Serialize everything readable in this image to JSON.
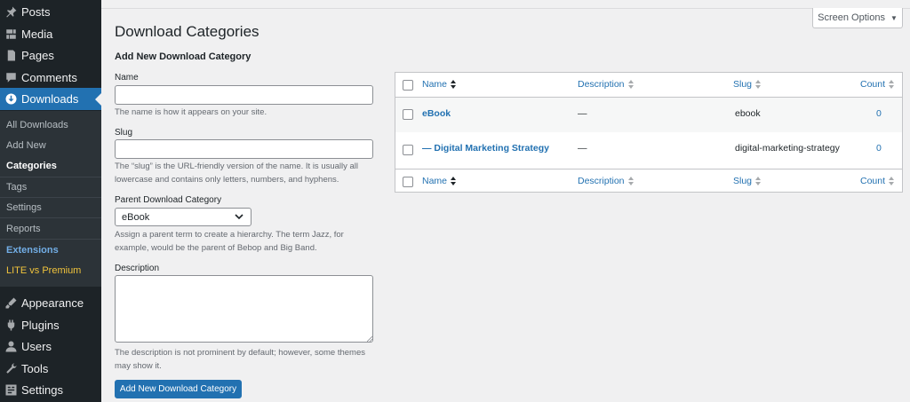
{
  "sidebar": {
    "items": [
      {
        "label": "Posts",
        "icon": "pin-icon"
      },
      {
        "label": "Media",
        "icon": "media-icon"
      },
      {
        "label": "Pages",
        "icon": "pages-icon"
      },
      {
        "label": "Comments",
        "icon": "comments-icon"
      },
      {
        "label": "Downloads",
        "icon": "download-icon"
      },
      {
        "label": "Appearance",
        "icon": "brush-icon"
      },
      {
        "label": "Plugins",
        "icon": "plugin-icon"
      },
      {
        "label": "Users",
        "icon": "users-icon"
      },
      {
        "label": "Tools",
        "icon": "wrench-icon"
      },
      {
        "label": "Settings",
        "icon": "settings-icon"
      }
    ],
    "submenu": [
      "All Downloads",
      "Add New",
      "Categories",
      "Tags",
      "Settings",
      "Reports",
      "Extensions",
      "LITE vs Premium"
    ]
  },
  "screen_options": "Screen Options",
  "page_title": "Download Categories",
  "form": {
    "title": "Add New Download Category",
    "name_label": "Name",
    "name_value": "",
    "name_help": "The name is how it appears on your site.",
    "slug_label": "Slug",
    "slug_value": "",
    "slug_help": "The “slug” is the URL-friendly version of the name. It is usually all lowercase and contains only letters, numbers, and hyphens.",
    "parent_label": "Parent Download Category",
    "parent_value": "eBook",
    "parent_help": "Assign a parent term to create a hierarchy. The term Jazz, for example, would be the parent of Bebop and Big Band.",
    "description_label": "Description",
    "description_help": "The description is not prominent by default; however, some themes may show it.",
    "submit_label": "Add New Download Category"
  },
  "table": {
    "columns": {
      "name": "Name",
      "description": "Description",
      "slug": "Slug",
      "count": "Count"
    },
    "rows": [
      {
        "name": "eBook",
        "description": "—",
        "slug": "ebook",
        "count": "0"
      },
      {
        "name": "— Digital Marketing Strategy",
        "description": "—",
        "slug": "digital-marketing-strategy",
        "count": "0"
      }
    ]
  },
  "colors": {
    "admin_bar": "#1d2327",
    "accent": "#2271b1",
    "submenu_bg": "#2c3338",
    "premium": "#f0c33c",
    "extensions": "#72aee6"
  }
}
